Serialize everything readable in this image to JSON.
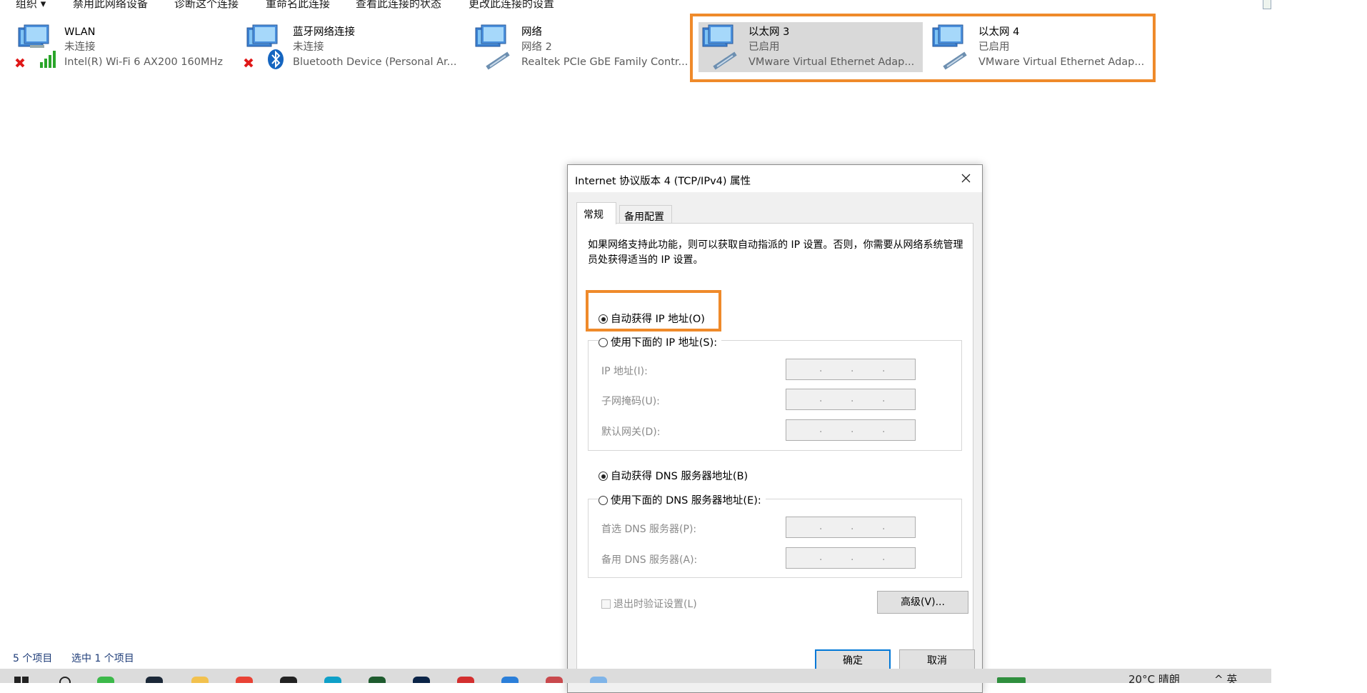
{
  "command_bar": {
    "organize": "组织 ▾",
    "disable": "禁用此网络设备",
    "diagnose": "诊断这个连接",
    "rename": "重命名此连接",
    "view_status": "查看此连接的状态",
    "change_settings": "更改此连接的设置"
  },
  "adapters": [
    {
      "name": "WLAN",
      "status": "未连接",
      "device": "Intel(R) Wi-Fi 6 AX200 160MHz",
      "icon": "wifi-adapter-icon"
    },
    {
      "name": "蓝牙网络连接",
      "status": "未连接",
      "device": "Bluetooth Device (Personal Ar...",
      "icon": "bluetooth-adapter-icon"
    },
    {
      "name": "网络",
      "status": "网络 2",
      "device": "Realtek PCIe GbE Family Contr...",
      "icon": "ethernet-adapter-icon"
    },
    {
      "name": "以太网 3",
      "status": "已启用",
      "device": "VMware Virtual Ethernet Adap...",
      "icon": "ethernet-adapter-icon"
    },
    {
      "name": "以太网 4",
      "status": "已启用",
      "device": "VMware Virtual Ethernet Adap...",
      "icon": "ethernet-adapter-icon"
    }
  ],
  "dialog": {
    "title": "Internet 协议版本 4 (TCP/IPv4) 属性",
    "tabs": [
      "常规",
      "备用配置"
    ],
    "description": "如果网络支持此功能，则可以获取自动指派的 IP 设置。否则，你需要从网络系统管理员处获得适当的 IP 设置。",
    "auto_ip": "自动获得 IP 地址(O)",
    "manual_ip": "使用下面的 IP 地址(S):",
    "ip_address_label": "IP 地址(I):",
    "subnet_label": "子网掩码(U):",
    "gateway_label": "默认网关(D):",
    "auto_dns": "自动获得 DNS 服务器地址(B)",
    "manual_dns": "使用下面的 DNS 服务器地址(E):",
    "preferred_dns_label": "首选 DNS 服务器(P):",
    "alternate_dns_label": "备用 DNS 服务器(A):",
    "validate_on_exit": "退出时验证设置(L)",
    "advanced_button": "高级(V)...",
    "ok_button": "确定",
    "cancel_button": "取消",
    "ip_dot": "."
  },
  "status_bar": {
    "item_count": "5 个项目",
    "selected_count": "选中 1 个项目"
  },
  "taskbar": {
    "weather_text": "20°C  晴朗",
    "tray_text": "^  英"
  },
  "colors": {
    "highlight": "#ef8a2a",
    "selected_tile": "#d9d9d9",
    "primary_button_border": "#0078d7",
    "status_text": "#1e3c78"
  }
}
